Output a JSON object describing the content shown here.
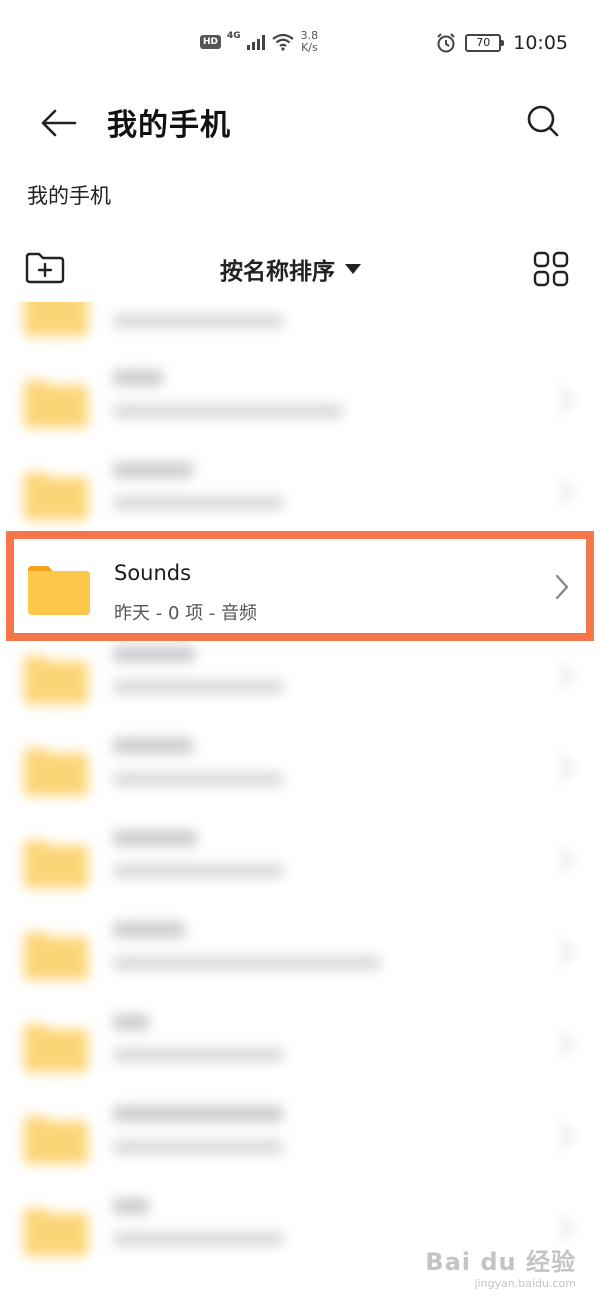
{
  "status_bar": {
    "hd": "HD",
    "network": "4G",
    "speed_value": "3.8",
    "speed_unit": "K/s",
    "battery": "70",
    "time": "10:05"
  },
  "header": {
    "title": "我的手机",
    "back_icon": "arrow-left-icon",
    "search_icon": "search-icon"
  },
  "breadcrumb": "我的手机",
  "toolbar": {
    "sort_label": "按名称排序",
    "new_folder_icon": "folder-add-icon",
    "view_icon": "grid-view-icon"
  },
  "highlighted_item": {
    "name": "Sounds",
    "meta": "昨天 - 0 项 - 音频"
  },
  "colors": {
    "highlight_border": "#f4764a",
    "folder": "#fcc74a"
  },
  "watermark": {
    "main": "Bai du 经验",
    "sub": "jingyan.baidu.com"
  }
}
